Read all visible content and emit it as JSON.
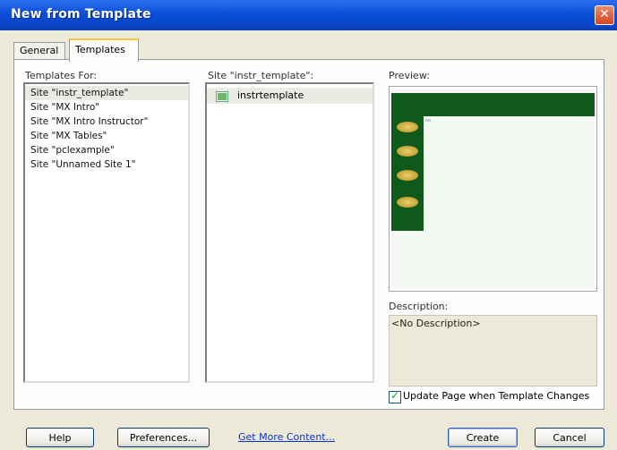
{
  "window": {
    "title": "New from Template",
    "close_glyph": "✕"
  },
  "tabs": [
    {
      "label": "General"
    },
    {
      "label": "Templates"
    }
  ],
  "templates_for": {
    "label": "Templates For:",
    "items": [
      "Site \"instr_template\"",
      "Site \"MX Intro\"",
      "Site \"MX Intro Instructor\"",
      "Site \"MX Tables\"",
      "Site \"pclexample\"",
      "Site \"Unnamed Site 1\""
    ],
    "selected_index": 0
  },
  "site_templates": {
    "label": "Site \"instr_template\":",
    "items": [
      "instrtemplate"
    ]
  },
  "preview": {
    "label": "Preview:"
  },
  "description": {
    "label": "Description:",
    "value": "<No Description>"
  },
  "update_checkbox": {
    "label": "Update Page when Template Changes",
    "checked": true
  },
  "buttons": {
    "help": "Help",
    "preferences": "Preferences...",
    "get_more": "Get More Content...",
    "create": "Create",
    "cancel": "Cancel"
  }
}
